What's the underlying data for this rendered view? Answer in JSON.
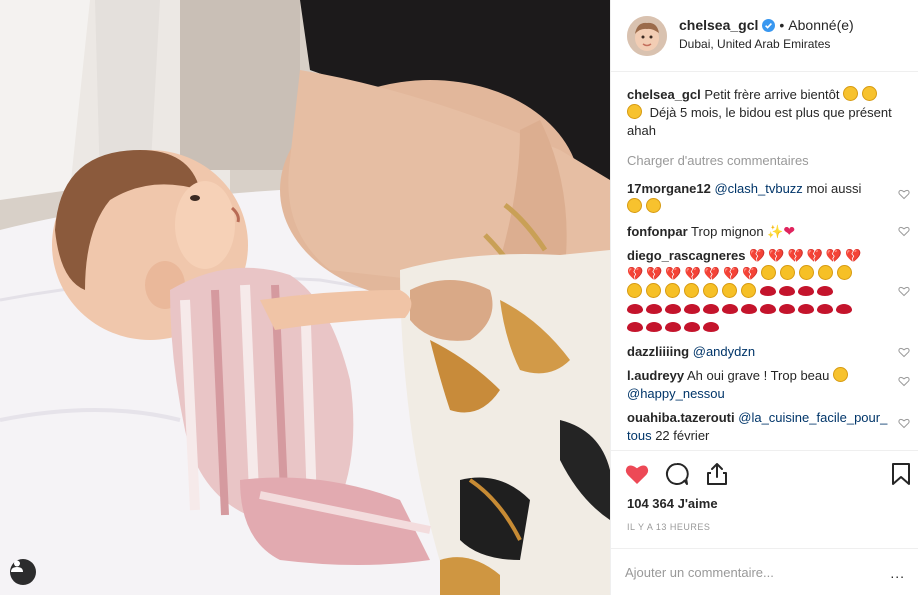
{
  "header": {
    "username": "chelsea_gcl",
    "separator": "•",
    "follow_label": "Abonné(e)",
    "location": "Dubai, United Arab Emirates",
    "more": "..."
  },
  "caption": {
    "username": "chelsea_gcl",
    "text": "Petit frère arrive bientôt",
    "text2": "Déjà 5 mois, le bidou est plus que présent ahah"
  },
  "load_more": "Charger d'autres commentaires",
  "comments": [
    {
      "username": "17morgane12",
      "mention": "@clash_tvbuzz",
      "text": " moi aussi"
    },
    {
      "username": "fonfonpar",
      "text": "Trop mignon"
    },
    {
      "username": "diego_rascagneres",
      "text": ""
    },
    {
      "username": "dazzliiiing",
      "mention": "@andydzn",
      "text": ""
    },
    {
      "username": "l.audreyy",
      "text": "Ah oui grave ! Trop beau",
      "mention": "@happy_nessou"
    },
    {
      "username": "ouahiba.tazerouti",
      "mention": "@la_cuisine_facile_pour_tous",
      "text": " 22 février"
    }
  ],
  "likes": "104 364 J'aime",
  "time": "IL Y A 13 HEURES",
  "add_comment_placeholder": "Ajouter un commentaire...",
  "colors": {
    "like": "#ed4956",
    "verified": "#3897f0",
    "mention": "#003569"
  },
  "icons": [
    "heart-icon",
    "comment-icon",
    "share-icon",
    "bookmark-icon",
    "verified-icon",
    "user-tag-icon"
  ]
}
